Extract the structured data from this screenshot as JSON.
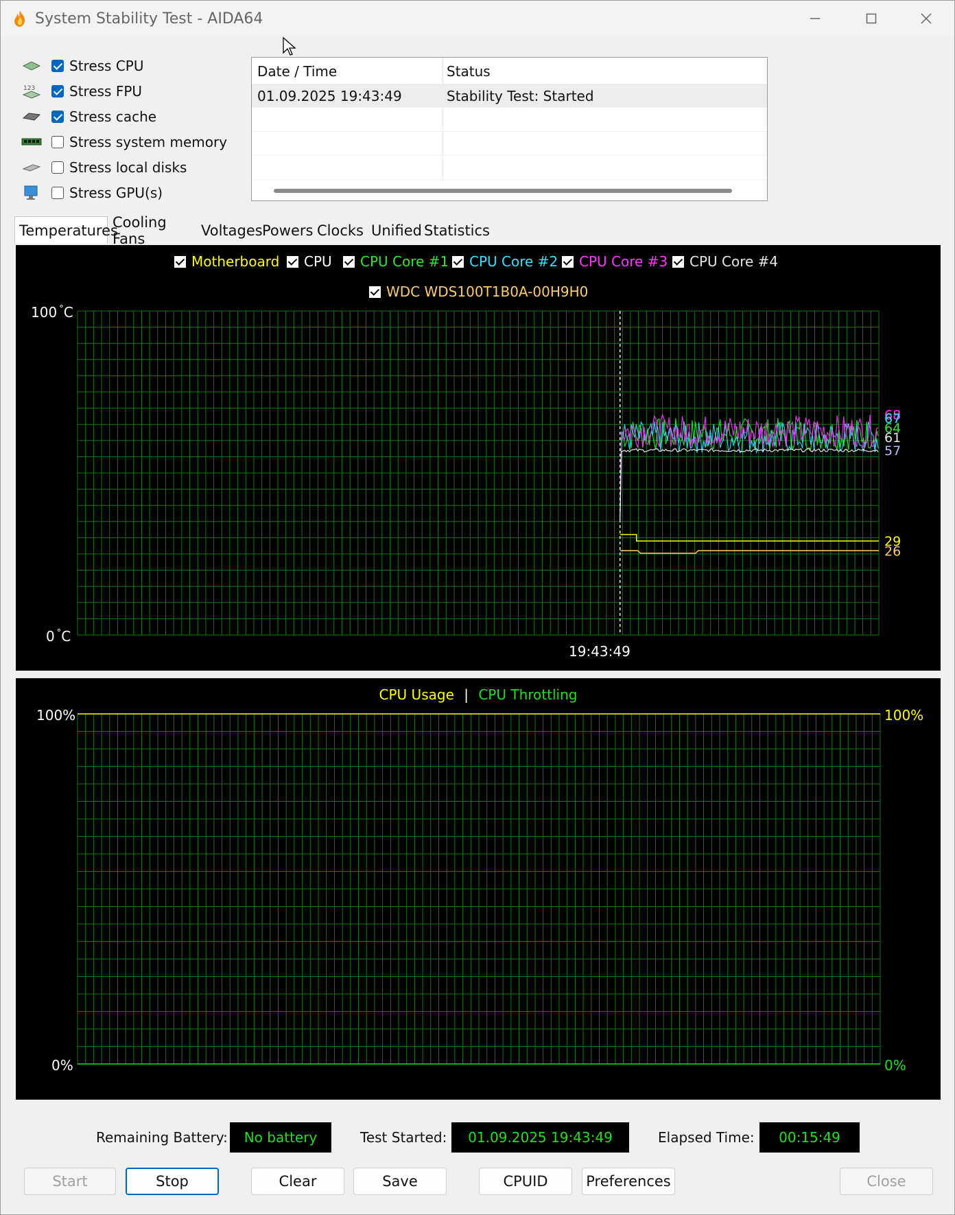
{
  "window": {
    "title": "System Stability Test - AIDA64",
    "controls": {
      "minimize": "minimize-icon",
      "maximize": "maximize-icon",
      "close": "close-icon"
    }
  },
  "options": [
    {
      "label": "Stress CPU",
      "checked": true,
      "icon": "cpu-chip-icon"
    },
    {
      "label": "Stress FPU",
      "checked": true,
      "icon": "fpu-123-icon"
    },
    {
      "label": "Stress cache",
      "checked": true,
      "icon": "cache-chip-icon"
    },
    {
      "label": "Stress system memory",
      "checked": false,
      "icon": "memory-module-icon"
    },
    {
      "label": "Stress local disks",
      "checked": false,
      "icon": "disk-drive-icon"
    },
    {
      "label": "Stress GPU(s)",
      "checked": false,
      "icon": "gpu-monitor-icon"
    }
  ],
  "log": {
    "columns": [
      "Date / Time",
      "Status"
    ],
    "rows": [
      {
        "datetime": "01.09.2025 19:43:49",
        "status": "Stability Test: Started"
      }
    ]
  },
  "tabs": [
    {
      "label": "Temperatures",
      "active": true
    },
    {
      "label": "Cooling Fans",
      "active": false
    },
    {
      "label": "Voltages",
      "active": false
    },
    {
      "label": "Powers",
      "active": false
    },
    {
      "label": "Clocks",
      "active": false
    },
    {
      "label": "Unified",
      "active": false
    },
    {
      "label": "Statistics",
      "active": false
    }
  ],
  "colors": {
    "motherboard": "#ffff00",
    "cpu": "#ffffff",
    "core1": "#2ee82e",
    "core2": "#33e0ff",
    "core3": "#ff33ff",
    "core4": "#e6e6e6",
    "wdc": "#ffcc66",
    "grid": "#0f7a0f",
    "value_green": "#1ee01e"
  },
  "chart_data": [
    {
      "type": "line",
      "legend": [
        {
          "name": "Motherboard",
          "checked": true,
          "color": "#ffff00"
        },
        {
          "name": "CPU",
          "checked": true,
          "color": "#ffffff"
        },
        {
          "name": "CPU Core #1",
          "checked": true,
          "color": "#2ee82e"
        },
        {
          "name": "CPU Core #2",
          "checked": true,
          "color": "#33e0ff"
        },
        {
          "name": "CPU Core #3",
          "checked": true,
          "color": "#ff33ff"
        },
        {
          "name": "CPU Core #4",
          "checked": true,
          "color": "#e6e6e6"
        },
        {
          "name": "WDC WDS100T1B0A-00H9H0",
          "checked": true,
          "color": "#ffcc66"
        }
      ],
      "y_max_label": "100",
      "y_min_label": "0",
      "y_unit": "°C",
      "ylim": [
        0,
        100
      ],
      "x_tick_label": "19:43:49",
      "start_fraction": 0.677,
      "current_values": [
        {
          "label": "68",
          "color": "#ff33ff",
          "value": 68
        },
        {
          "label": "67",
          "color": "#33e0ff",
          "value": 67
        },
        {
          "label": "64",
          "color": "#2ee82e",
          "value": 64
        },
        {
          "label": "61",
          "color": "#e6e6e6",
          "value": 61
        },
        {
          "label": "57",
          "color": "#b8b8ff",
          "value": 57
        },
        {
          "label": "29",
          "color": "#ffff00",
          "value": 29
        },
        {
          "label": "26",
          "color": "#ffcc66",
          "value": 26
        }
      ],
      "series": [
        {
          "name": "CPU Core #1",
          "color": "#2ee82e",
          "base": 62,
          "amp": 5
        },
        {
          "name": "CPU Core #2",
          "color": "#33e0ff",
          "base": 61,
          "amp": 5
        },
        {
          "name": "CPU Core #3",
          "color": "#ff33ff",
          "base": 63,
          "amp": 5
        },
        {
          "name": "CPU",
          "color": "#ffffff",
          "base": 57,
          "amp": 0.5
        }
      ],
      "motherboard_value": 29,
      "wdc_value": 26
    },
    {
      "type": "line",
      "legend": [
        {
          "name": "CPU Usage",
          "color": "#ffff00"
        },
        {
          "name": "|",
          "color": "#ffffff"
        },
        {
          "name": "CPU Throttling",
          "color": "#1ee01e"
        }
      ],
      "left_top": "100%",
      "left_bottom": "0%",
      "right_top": "100%",
      "right_bottom": "0%",
      "ylim": [
        0,
        100
      ]
    }
  ],
  "status": {
    "battery_label": "Remaining Battery:",
    "battery_value": "No battery",
    "started_label": "Test Started:",
    "started_value": "01.09.2025 19:43:49",
    "elapsed_label": "Elapsed Time:",
    "elapsed_value": "00:15:49"
  },
  "buttons": {
    "start": "Start",
    "stop": "Stop",
    "clear": "Clear",
    "save": "Save",
    "cpuid": "CPUID",
    "preferences": "Preferences",
    "close": "Close"
  }
}
